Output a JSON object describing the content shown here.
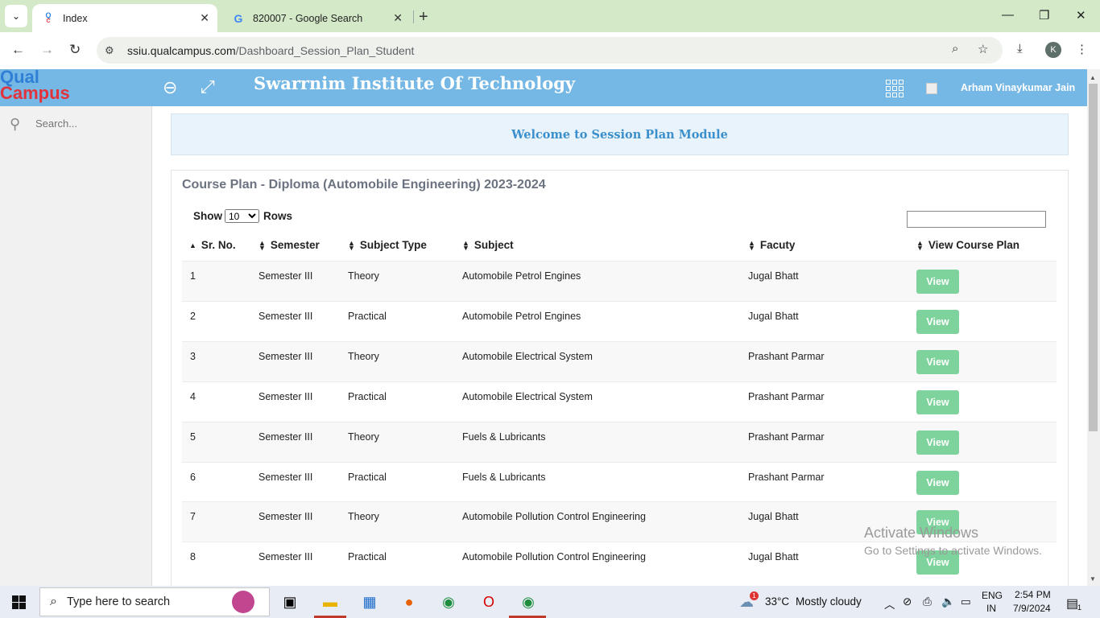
{
  "browser": {
    "tabs": [
      {
        "title": "Index",
        "favicon": "qualcampus-favicon",
        "active": true
      },
      {
        "title": "820007 - Google Search",
        "favicon": "google-icon",
        "active": false
      }
    ],
    "url_host": "ssiu.qualcampus.com",
    "url_path": "/Dashboard_Session_Plan_Student",
    "profile_initial": "K"
  },
  "header": {
    "logo_line1": "Qual",
    "logo_line2": "Campus",
    "institute": "Swarrnim Institute Of Technology",
    "user_name": "Arham Vinaykumar Jain"
  },
  "sidebar": {
    "search_placeholder": "Search..."
  },
  "welcome_text": "Welcome to Session Plan Module",
  "course": {
    "title": "Course Plan - Diploma (Automobile Engineering) 2023-2024",
    "show_label": "Show",
    "rows_label": "Rows",
    "page_size": "10",
    "columns": [
      "Sr. No.",
      "Semester",
      "Subject Type",
      "Subject",
      "Facuty",
      "View Course Plan"
    ],
    "rows": [
      {
        "sr": "1",
        "semester": "Semester III",
        "type": "Theory",
        "subject": "Automobile Petrol Engines",
        "faculty": "Jugal Bhatt",
        "action": "View"
      },
      {
        "sr": "2",
        "semester": "Semester III",
        "type": "Practical",
        "subject": "Automobile Petrol Engines",
        "faculty": "Jugal Bhatt",
        "action": "View"
      },
      {
        "sr": "3",
        "semester": "Semester III",
        "type": "Theory",
        "subject": "Automobile Electrical System",
        "faculty": "Prashant Parmar",
        "action": "View"
      },
      {
        "sr": "4",
        "semester": "Semester III",
        "type": "Practical",
        "subject": "Automobile Electrical System",
        "faculty": "Prashant Parmar",
        "action": "View"
      },
      {
        "sr": "5",
        "semester": "Semester III",
        "type": "Theory",
        "subject": "Fuels & Lubricants",
        "faculty": "Prashant Parmar",
        "action": "View"
      },
      {
        "sr": "6",
        "semester": "Semester III",
        "type": "Practical",
        "subject": "Fuels & Lubricants",
        "faculty": "Prashant Parmar",
        "action": "View"
      },
      {
        "sr": "7",
        "semester": "Semester III",
        "type": "Theory",
        "subject": "Automobile Pollution Control Engineering",
        "faculty": "Jugal Bhatt",
        "action": "View"
      },
      {
        "sr": "8",
        "semester": "Semester III",
        "type": "Practical",
        "subject": "Automobile Pollution Control Engineering",
        "faculty": "Jugal Bhatt",
        "action": "View"
      }
    ]
  },
  "watermark": {
    "line1": "Activate Windows",
    "line2": "Go to Settings to activate Windows."
  },
  "taskbar": {
    "search_placeholder": "Type here to search",
    "weather_temp": "33°C",
    "weather_desc": "Mostly cloudy",
    "lang1": "ENG",
    "lang2": "IN",
    "time": "2:54 PM",
    "date": "7/9/2024",
    "weather_badge": "1",
    "notification_count": "1"
  },
  "colors": {
    "header_blue": "#76b8e5",
    "view_green": "#7dd39b",
    "welcome_text": "#3a8fcc"
  }
}
